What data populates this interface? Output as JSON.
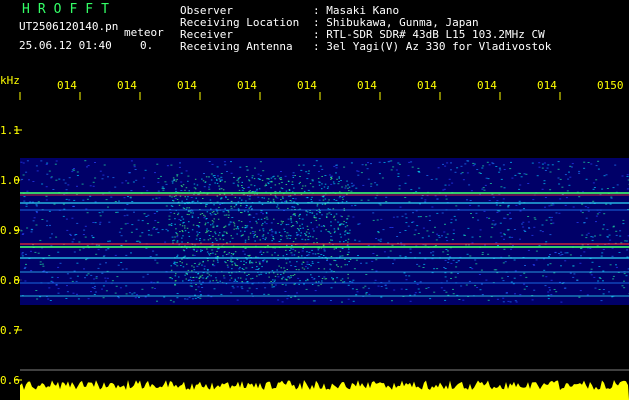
{
  "header": {
    "app_name": "HROFFT",
    "filename": "UT2506120140.pn",
    "mode": "meteor",
    "datetime": "25.06.12 01:40",
    "counter": "0.",
    "info": [
      {
        "label": "Observer",
        "value": ": Masaki Kano"
      },
      {
        "label": "Receiving Location",
        "value": ": Shibukawa, Gunma, Japan"
      },
      {
        "label": "Receiver",
        "value": ": RTL-SDR SDR# 43dB L15 103.2MHz CW"
      },
      {
        "label": "Receiving Antenna",
        "value": ": 3el Yagi(V) Az 330 for Vladivostok"
      }
    ]
  },
  "axes": {
    "y_unit": "kHz",
    "y_ticks": [
      "1.1",
      "1.0",
      "0.9",
      "0.8",
      "0.7",
      "0.6"
    ],
    "x_ticks": [
      "014",
      "014",
      "014",
      "014",
      "014",
      "014",
      "014",
      "014",
      "014",
      "0150"
    ]
  },
  "colors": {
    "title": "#33ff66",
    "text": "#ffffff",
    "tick": "#ffff00",
    "background": "#000000",
    "waterfall_bg": "#00007a",
    "noise_floor": "#ffff00"
  }
}
